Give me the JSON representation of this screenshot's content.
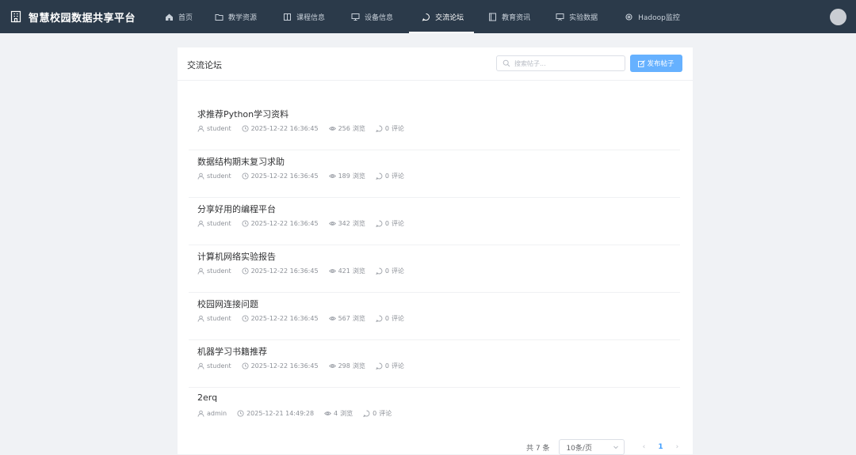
{
  "app": {
    "title": "智慧校园数据共享平台"
  },
  "nav": {
    "items": [
      {
        "label": "首页",
        "icon": "home-icon"
      },
      {
        "label": "教学资源",
        "icon": "folder-icon"
      },
      {
        "label": "课程信息",
        "icon": "book-icon"
      },
      {
        "label": "设备信息",
        "icon": "monitor-icon"
      },
      {
        "label": "交流论坛",
        "icon": "chat-icon",
        "active": true
      },
      {
        "label": "教育资讯",
        "icon": "news-icon"
      },
      {
        "label": "实验数据",
        "icon": "chart-board-icon"
      },
      {
        "label": "Hadoop监控",
        "icon": "gear-icon"
      }
    ]
  },
  "forum": {
    "title": "交流论坛",
    "search_placeholder": "搜索帖子...",
    "publish_label": "发布帖子"
  },
  "posts": [
    {
      "title": "求推荐Python学习资料",
      "author": "student",
      "time": "2025-12-22 16:36:45",
      "views": "256",
      "comments": "0"
    },
    {
      "title": "数据结构期末复习求助",
      "author": "student",
      "time": "2025-12-22 16:36:45",
      "views": "189",
      "comments": "0"
    },
    {
      "title": "分享好用的编程平台",
      "author": "student",
      "time": "2025-12-22 16:36:45",
      "views": "342",
      "comments": "0"
    },
    {
      "title": "计算机网络实验报告",
      "author": "student",
      "time": "2025-12-22 16:36:45",
      "views": "421",
      "comments": "0"
    },
    {
      "title": "校园网连接问题",
      "author": "student",
      "time": "2025-12-22 16:36:45",
      "views": "567",
      "comments": "0"
    },
    {
      "title": "机器学习书籍推荐",
      "author": "student",
      "time": "2025-12-22 16:36:45",
      "views": "298",
      "comments": "0"
    },
    {
      "title": "2erq",
      "author": "admin",
      "time": "2025-12-21 14:49:28",
      "views": "4",
      "comments": "0"
    }
  ],
  "labels": {
    "views_suffix": "浏览",
    "comments_suffix": "评论"
  },
  "pagination": {
    "total_text": "共 7 条",
    "page_size": "10条/页",
    "current_page": "1",
    "prev": "‹",
    "next": "›"
  },
  "colors": {
    "topbar": "#2b3a4a",
    "accent": "#409eff",
    "button": "#66b1ff"
  }
}
